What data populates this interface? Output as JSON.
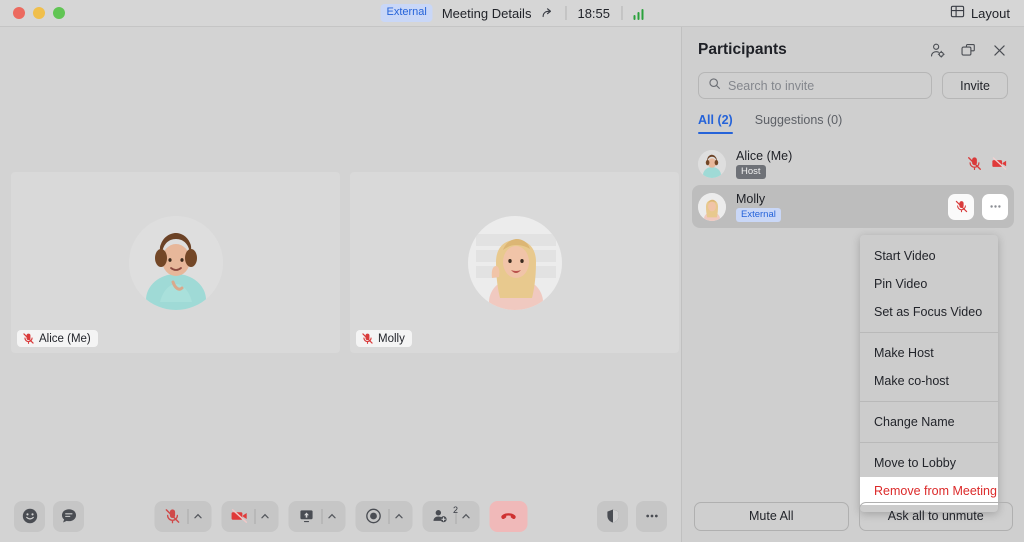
{
  "titlebar": {
    "external_badge": "External",
    "meeting_details": "Meeting Details",
    "share_icon": "share-arrow-icon",
    "time": "18:55",
    "signal_icon": "network-signal-icon",
    "layout_label": "Layout",
    "layout_icon": "grid-layout-icon",
    "window_controls": [
      "close",
      "minimize",
      "maximize"
    ]
  },
  "stage": {
    "tiles": [
      {
        "name": "Alice (Me)",
        "muted": true,
        "avatar": "alice-avatar"
      },
      {
        "name": "Molly",
        "muted": true,
        "avatar": "molly-avatar"
      }
    ]
  },
  "toolbar": {
    "reactions_icon": "emoji-smiley-icon",
    "chat_icon": "chat-bubble-icon",
    "mic_icon": "microphone-muted-icon",
    "camera_icon": "camera-off-icon",
    "share_icon": "share-screen-icon",
    "record_icon": "record-icon",
    "participants_icon": "add-participant-icon",
    "participants_count": "2",
    "endcall_icon": "end-call-icon",
    "security_icon": "shield-icon",
    "more_icon": "more-horizontal-icon"
  },
  "panel": {
    "title": "Participants",
    "header_icons": [
      "manage-participants-icon",
      "popout-window-icon",
      "close-icon"
    ],
    "search": {
      "placeholder": "Search to invite",
      "value": "",
      "icon": "search-icon"
    },
    "invite_label": "Invite",
    "tabs": [
      {
        "label": "All (2)",
        "active": true
      },
      {
        "label": "Suggestions (0)",
        "active": false
      }
    ],
    "participants": [
      {
        "name": "Alice (Me)",
        "tag": "Host",
        "tag_type": "host",
        "avatar": "alice-avatar",
        "selected": false,
        "actions": [
          "microphone-muted-icon",
          "camera-off-icon"
        ]
      },
      {
        "name": "Molly",
        "tag": "External",
        "tag_type": "external",
        "avatar": "molly-avatar",
        "selected": true,
        "actions": [
          "microphone-muted-icon",
          "more-options-icon"
        ]
      }
    ],
    "context_menu": {
      "groups": [
        [
          "Start Video",
          "Pin Video",
          "Set as Focus Video"
        ],
        [
          "Make Host",
          "Make co-host"
        ],
        [
          "Change Name"
        ],
        [
          "Move to Lobby",
          "Remove from Meeting"
        ]
      ],
      "danger_item": "Remove from Meeting"
    },
    "footer": {
      "mute_all": "Mute All",
      "ask_unmute": "Ask all to unmute"
    }
  },
  "colors": {
    "accent": "#2563d9",
    "danger": "#dc2a2a",
    "mute_red": "#d93b3b",
    "signal_green": "#2aa13c"
  }
}
